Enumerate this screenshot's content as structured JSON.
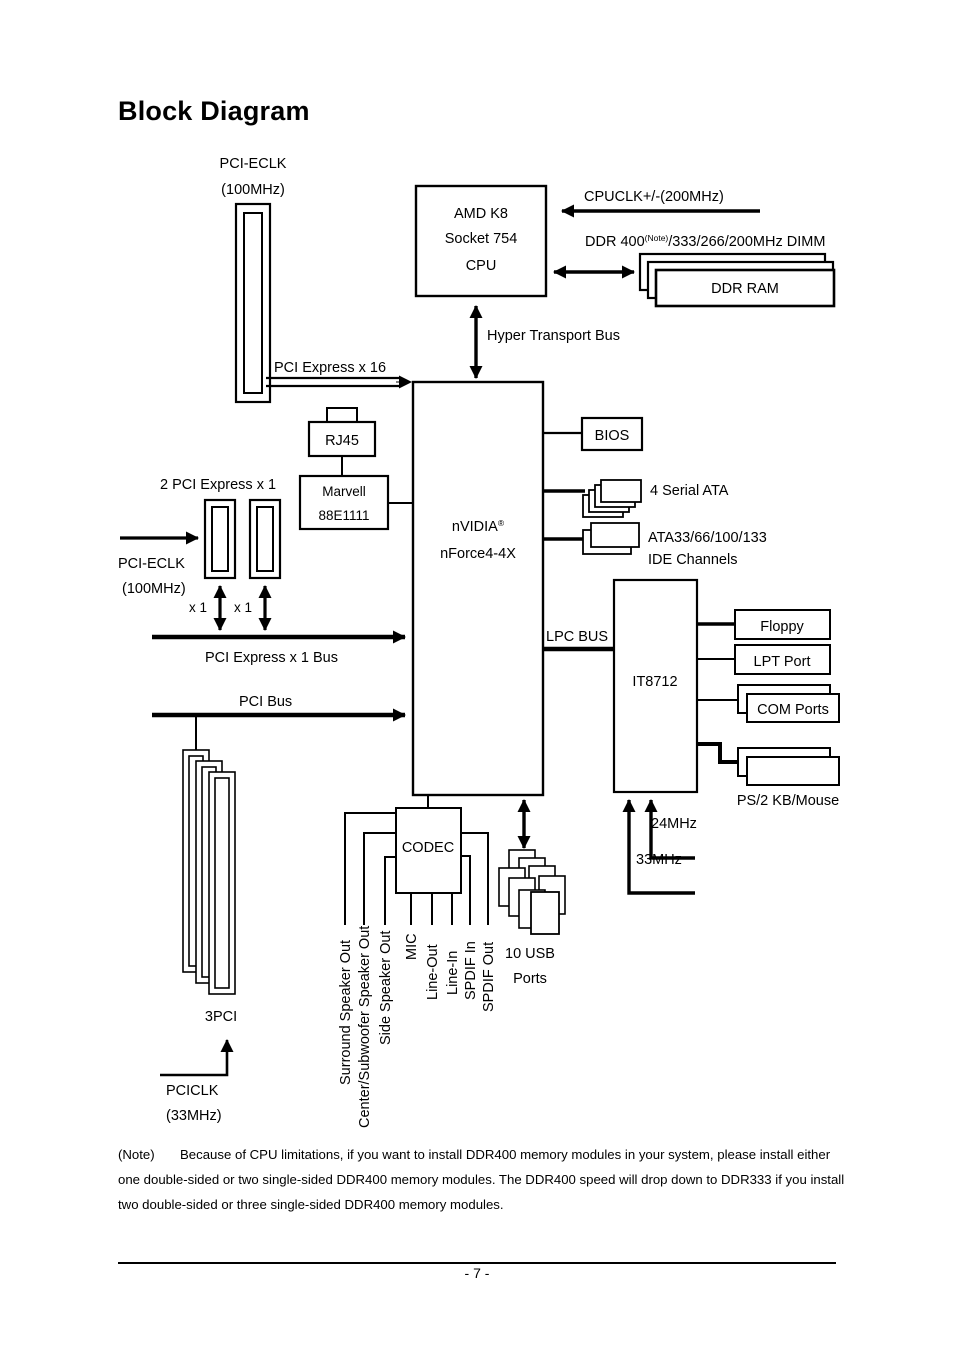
{
  "page": {
    "title": "Block Diagram",
    "page_number": "- 7 -"
  },
  "blocks": {
    "cpu_line1": "AMD K8",
    "cpu_line2": "Socket 754",
    "cpu_line3": "CPU",
    "chipset_line1": "nVIDIA",
    "chipset_sup": "®",
    "chipset_line2": "nForce4-4X",
    "ddr_ram": "DDR RAM",
    "bios": "BIOS",
    "rj45": "RJ45",
    "marvell_line1": "Marvell",
    "marvell_line2": "88E1111",
    "codec": "CODEC",
    "superio": "IT8712",
    "floppy": "Floppy",
    "lpt_port": "LPT Port",
    "com_ports": "COM Ports"
  },
  "labels": {
    "pci_eclk_top": "PCI-ECLK",
    "pci_eclk_top_freq": "(100MHz)",
    "pci_eclk_left": "PCI-ECLK",
    "pci_eclk_left_freq": "(100MHz)",
    "cpuclk": "CPUCLK+/-(200MHz)",
    "ddr_dimm_pre": "DDR 400",
    "ddr_dimm_note": "(Note)",
    "ddr_dimm_post": "/333/266/200MHz DIMM",
    "hyper_transport": "Hyper Transport Bus",
    "pcie_x16": "PCI Express x 16",
    "two_pcie_x1": "2 PCI Express x 1",
    "x1_a": "x 1",
    "x1_b": "x 1",
    "pcie_x1_bus": "PCI Express x 1 Bus",
    "pci_bus": "PCI Bus",
    "lpc_bus": "LPC BUS",
    "serial_ata": "4 Serial ATA",
    "ide_line1": "ATA33/66/100/133",
    "ide_line2": "IDE Channels",
    "ps2": "PS/2 KB/Mouse",
    "clk_24": "24MHz",
    "clk_33": "33MHz",
    "usb_line1": "10 USB",
    "usb_line2": "Ports",
    "three_pci": "3PCI",
    "pciclk": "PCICLK",
    "pciclk_freq": "(33MHz)"
  },
  "audio_ports": [
    "Surround Speaker Out",
    "Center/Subwoofer Speaker Out",
    "Side Speaker Out",
    "MIC",
    "Line-Out",
    "Line-In",
    "SPDIF In",
    "SPDIF Out"
  ],
  "footnote": {
    "tag": "(Note)",
    "text": "Because of CPU limitations, if you want to install DDR400 memory modules in your system, please install either one double-sided or two single-sided DDR400 memory modules. The DDR400 speed will drop down to DDR333 if you install two double-sided or three single-sided DDR400 memory modules."
  },
  "colors": {
    "ink": "#000000",
    "paper": "#ffffff"
  }
}
